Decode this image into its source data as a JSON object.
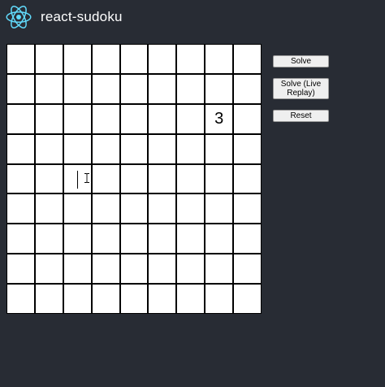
{
  "header": {
    "title": "react-sudoku",
    "logo_icon": "react-atom-icon",
    "logo_color": "#61dafb"
  },
  "colors": {
    "background": "#282c34",
    "cell_background": "#ffffff",
    "grid_lines": "#000000"
  },
  "board": {
    "rows": [
      [
        "",
        "",
        "",
        "",
        "",
        "",
        "",
        "",
        ""
      ],
      [
        "",
        "",
        "",
        "",
        "",
        "",
        "",
        "",
        ""
      ],
      [
        "",
        "",
        "",
        "",
        "",
        "",
        "",
        "3",
        ""
      ],
      [
        "",
        "",
        "",
        "",
        "",
        "",
        "",
        "",
        ""
      ],
      [
        "",
        "",
        "",
        "",
        "",
        "",
        "",
        "",
        ""
      ],
      [
        "",
        "",
        "",
        "",
        "",
        "",
        "",
        "",
        ""
      ],
      [
        "",
        "",
        "",
        "",
        "",
        "",
        "",
        "",
        ""
      ],
      [
        "",
        "",
        "",
        "",
        "",
        "",
        "",
        "",
        ""
      ],
      [
        "",
        "",
        "",
        "",
        "",
        "",
        "",
        "",
        ""
      ]
    ],
    "focused_cell": {
      "row": 4,
      "col": 2
    }
  },
  "controls": {
    "solve_label": "Solve",
    "live_replay_label": "Solve (Live Replay)",
    "reset_label": "Reset"
  }
}
